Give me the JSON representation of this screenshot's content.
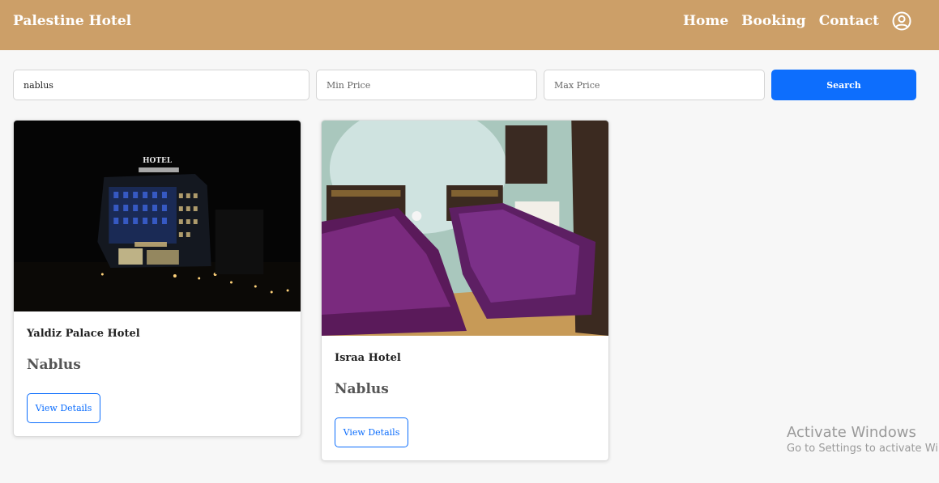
{
  "navbar": {
    "brand": "Palestine Hotel",
    "links": [
      "Home",
      "Booking",
      "Contact"
    ],
    "user_icon": "user-circle-icon"
  },
  "search": {
    "location_value": "nablus",
    "min_price_placeholder": "Min Price",
    "max_price_placeholder": "Max Price",
    "button_label": "Search"
  },
  "hotels": [
    {
      "name": "Yaldiz Palace Hotel",
      "city": "Nablus",
      "button_label": "View Details",
      "image": "hotel-building-night-photo"
    },
    {
      "name": "Israa Hotel",
      "city": "Nablus",
      "button_label": "View Details",
      "image": "twin-bedroom-purple-bedspreads-photo"
    }
  ],
  "watermark": {
    "line1": "Activate Windows",
    "line2": "Go to Settings to activate Windows."
  },
  "colors": {
    "navbar": "#cc9f68",
    "primary": "#0d6efd",
    "background": "#f7f7f7"
  }
}
